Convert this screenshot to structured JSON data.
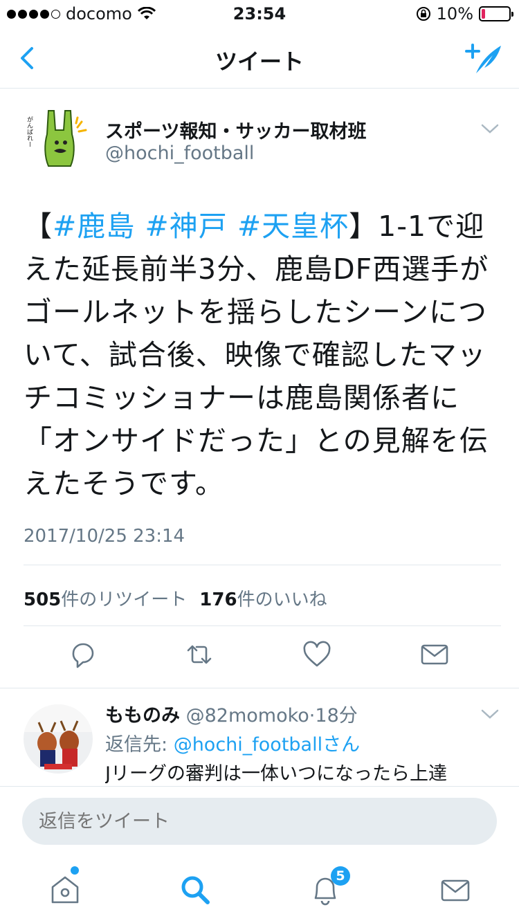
{
  "status_bar": {
    "carrier": "docomo",
    "time": "23:54",
    "battery": "10%",
    "signal_dots_filled": 4,
    "signal_dots_total": 5,
    "battery_level": 0.1
  },
  "nav": {
    "title": "ツイート"
  },
  "tweet": {
    "author_name": "スポーツ報知・サッカー取材班",
    "author_handle": "@hochi_football",
    "text_open": "【",
    "hashtags": [
      "#鹿島",
      "#神戸",
      "#天皇杯"
    ],
    "text_body": "】1-1で迎えた延長前半3分、鹿島DF西選手がゴールネットを揺らしたシーンについて、試合後、映像で確認したマッチコミッショナーは鹿島関係者に「オンサイドだった」との見解を伝えたそうです。",
    "timestamp": "2017/10/25 23:14",
    "retweet_count": "505",
    "retweet_label": "件のリツイート",
    "like_count": "176",
    "like_label": "件のいいね",
    "avatar_text": "がんばれー"
  },
  "reply": {
    "author_name": "もものみ",
    "author_handle": "@82momoko",
    "separator": "·",
    "time_ago": "18分",
    "reply_to_prefix": "返信先: ",
    "reply_to_handle": "@hochi_football",
    "reply_to_suffix": "さん",
    "text": "Jリーグの審判は一体いつになったら上達"
  },
  "composer": {
    "placeholder": "返信をツイート"
  },
  "tabbar": {
    "notification_badge": "5"
  },
  "colors": {
    "accent": "#1da1f2",
    "secondary_text": "#657786",
    "divider": "#e1e8ed",
    "input_bg": "#e6ecf0",
    "battery_low": "#e0245e"
  }
}
